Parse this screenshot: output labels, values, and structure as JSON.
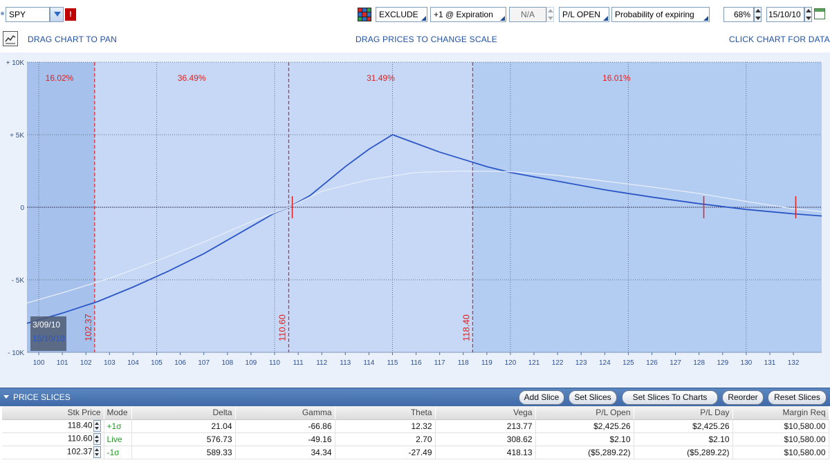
{
  "toolbar": {
    "symbol": "SPY",
    "alert_label": "!",
    "commissions": "EXCLUDE",
    "plot_what": "+1 @ Expiration",
    "step": "N/A",
    "pl_mode": "P/L OPEN",
    "probability_mode": "Probability of expiring",
    "price_range": "68%",
    "date": "15/10/10"
  },
  "links": {
    "pan": "DRAG CHART TO PAN",
    "scale": "DRAG PRICES TO CHANGE SCALE",
    "data": "CLICK CHART FOR DATA"
  },
  "chart_data": {
    "type": "line",
    "xlim": [
      99.5,
      133.2
    ],
    "ylim": [
      -10000,
      10000
    ],
    "x_ticks": [
      100,
      101,
      102,
      103,
      104,
      105,
      106,
      107,
      108,
      109,
      110,
      111,
      112,
      113,
      114,
      115,
      116,
      117,
      118,
      119,
      120,
      121,
      122,
      123,
      124,
      125,
      126,
      127,
      128,
      129,
      130,
      131,
      132
    ],
    "y_ticks": [
      {
        "value": 10000,
        "label": "+ 10K"
      },
      {
        "value": 5000,
        "label": "+ 5K"
      },
      {
        "value": 0,
        "label": "0"
      },
      {
        "value": -5000,
        "label": "- 5K"
      },
      {
        "value": -10000,
        "label": "- 10K"
      }
    ],
    "probability_zones": [
      {
        "from": 99.5,
        "to": 102.37,
        "label": "16.02%"
      },
      {
        "from": 102.37,
        "to": 110.6,
        "label": "36.49%"
      },
      {
        "from": 110.6,
        "to": 118.4,
        "label": "31.49%"
      },
      {
        "from": 118.4,
        "to": 133.2,
        "label": "16.01%"
      }
    ],
    "slice_lines": [
      {
        "x": 102.37,
        "label": "102.37"
      },
      {
        "x": 110.6,
        "label": "110.60"
      },
      {
        "x": 118.4,
        "label": "118.40"
      }
    ],
    "series": [
      {
        "color": "#2a56c6",
        "x": [
          99.5,
          101,
          102.5,
          104,
          105.5,
          107,
          108.5,
          110,
          110.6,
          111.5,
          113,
          114,
          115,
          116,
          117,
          118,
          119,
          120,
          122,
          124,
          126,
          128,
          130,
          132,
          133.2
        ],
        "y": [
          -8000,
          -7300,
          -6500,
          -5500,
          -4400,
          -3200,
          -1800,
          -400,
          0,
          800,
          2800,
          4000,
          5000,
          4400,
          3800,
          3300,
          2800,
          2400,
          1800,
          1200,
          700,
          250,
          -150,
          -450,
          -600
        ]
      },
      {
        "color": "#e8eef8",
        "x": [
          99.5,
          101,
          103,
          105,
          107,
          109,
          110.6,
          112,
          114,
          116,
          118,
          120,
          122,
          124,
          126,
          128,
          130,
          132,
          133.2
        ],
        "y": [
          -6600,
          -5900,
          -4900,
          -3700,
          -2400,
          -1000,
          0,
          1100,
          1900,
          2400,
          2500,
          2450,
          2200,
          1800,
          1400,
          950,
          400,
          -100,
          -300
        ]
      }
    ],
    "markers": [
      {
        "x": 110.75,
        "y": 0
      },
      {
        "x": 128.2,
        "y": 0
      },
      {
        "x": 132.1,
        "y": 0
      }
    ],
    "date_labels": [
      "3/09/10",
      "15/10/10"
    ],
    "colors": {
      "plot_bg": "#b3ccf2",
      "light_zone": "#c6d8f5",
      "outer_bg": "#eaf1fb",
      "zone_text": "#e02020",
      "axis_text": "#2d4f8f"
    }
  },
  "price_slices": {
    "title": "PRICE SLICES",
    "buttons": [
      "Add Slice",
      "Set Slices",
      "Set Slices To Charts",
      "Reorder",
      "Reset Slices"
    ],
    "columns": [
      "Stk Price",
      "Mode",
      "Delta",
      "Gamma",
      "Theta",
      "Vega",
      "P/L Open",
      "P/L Day",
      "Margin Req"
    ],
    "rows": [
      {
        "stk": "118.40",
        "mode": "+1σ",
        "delta": "21.04",
        "gamma": "-66.86",
        "theta": "12.32",
        "vega": "213.77",
        "pl_open": "$2,425.26",
        "pl_day": "$2,425.26",
        "margin": "$10,580.00"
      },
      {
        "stk": "110.60",
        "mode": "Live",
        "delta": "576.73",
        "gamma": "-49.16",
        "theta": "2.70",
        "vega": "308.62",
        "pl_open": "$2.10",
        "pl_day": "$2.10",
        "margin": "$10,580.00"
      },
      {
        "stk": "102.37",
        "mode": "-1σ",
        "delta": "589.33",
        "gamma": "34.34",
        "theta": "-27.49",
        "vega": "418.13",
        "pl_open": "($5,289.22)",
        "pl_day": "($5,289.22)",
        "margin": "$10,580.00"
      }
    ]
  }
}
